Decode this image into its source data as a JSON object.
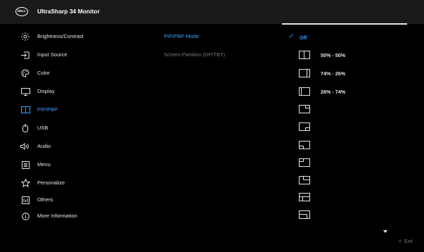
{
  "header": {
    "logo_text": "DELL",
    "title": "UltraSharp 34 Monitor"
  },
  "menu": [
    {
      "label": "Brightness/Contrast",
      "icon": "sun-icon"
    },
    {
      "label": "Input Source",
      "icon": "input-source-icon"
    },
    {
      "label": "Color",
      "icon": "palette-icon"
    },
    {
      "label": "Display",
      "icon": "monitor-icon"
    },
    {
      "label": "PIP/PBP",
      "icon": "pip-icon",
      "active": true
    },
    {
      "label": "USB",
      "icon": "usb-icon"
    },
    {
      "label": "Audio",
      "icon": "speaker-icon"
    },
    {
      "label": "Menu",
      "icon": "menu-icon"
    },
    {
      "label": "Personalize",
      "icon": "star-icon"
    },
    {
      "label": "Others",
      "icon": "others-icon"
    },
    {
      "label": "More Information",
      "icon": "info-icon"
    }
  ],
  "submenu": [
    {
      "label": "PIP/PBP Mode",
      "state": "active"
    },
    {
      "label": "Screen Partition (DP/TBT)",
      "state": "dim"
    }
  ],
  "options": {
    "off_label": "Off",
    "items": [
      {
        "label": "50% - 50%",
        "icon": "pbp-50-50-icon"
      },
      {
        "label": "74% - 26%",
        "icon": "pbp-74-26-icon"
      },
      {
        "label": "26% - 74%",
        "icon": "pbp-26-74-icon"
      },
      {
        "label": "",
        "icon": "pip-top-right-icon"
      },
      {
        "label": "",
        "icon": "pip-bottom-right-icon"
      },
      {
        "label": "",
        "icon": "pip-bottom-left-icon"
      },
      {
        "label": "",
        "icon": "pip-top-left-icon"
      },
      {
        "label": "",
        "icon": "pbp-layout-7-icon"
      },
      {
        "label": "",
        "icon": "pbp-layout-8-icon"
      },
      {
        "label": "",
        "icon": "pbp-layout-9-icon"
      }
    ]
  },
  "footer": {
    "exit_label": "Exit"
  },
  "colors": {
    "accent": "#3aa0ff",
    "text": "#e6e6e6",
    "dim": "#7a7a7a",
    "header_bg": "#1a1a1a"
  }
}
